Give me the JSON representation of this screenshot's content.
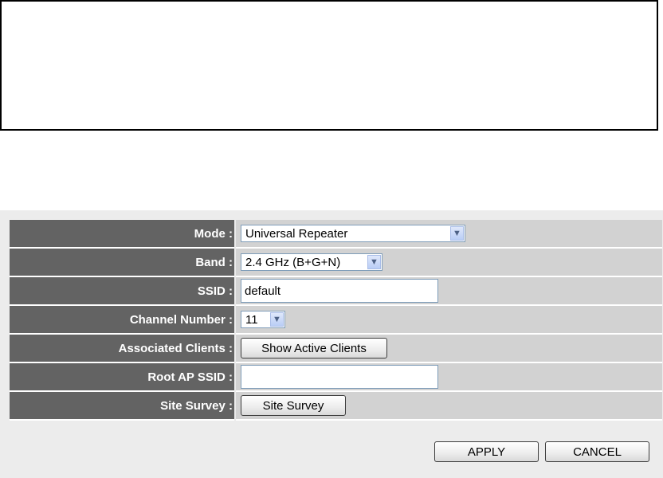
{
  "form": {
    "rows": [
      {
        "label": "Mode :",
        "value": "Universal Repeater"
      },
      {
        "label": "Band :",
        "value": "2.4 GHz (B+G+N)"
      },
      {
        "label": "SSID :",
        "value": "default"
      },
      {
        "label": "Channel Number :",
        "value": "11"
      },
      {
        "label": "Associated Clients :",
        "value": "Show Active Clients"
      },
      {
        "label": "Root AP SSID :",
        "value": ""
      },
      {
        "label": "Site Survey :",
        "value": "Site Survey"
      }
    ]
  },
  "buttons": {
    "apply": "APPLY",
    "cancel": "CANCEL"
  },
  "icons": {
    "dropdown": "chevron-down-icon"
  },
  "colors": {
    "label_bg": "#636363",
    "value_bg": "#d2d2d2",
    "panel_bg": "#ececec"
  }
}
